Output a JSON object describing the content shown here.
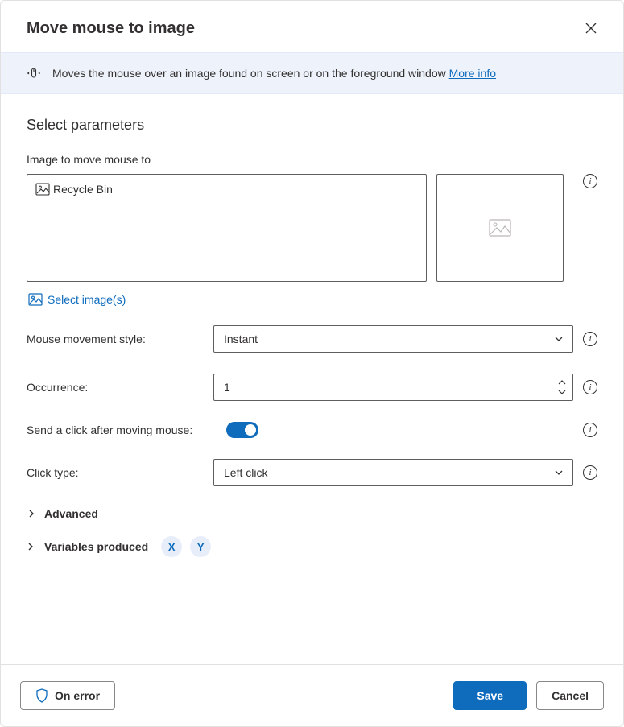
{
  "dialog": {
    "title": "Move mouse to image",
    "description": "Moves the mouse over an image found on screen or on the foreground window",
    "more_info": "More info"
  },
  "section_title": "Select parameters",
  "image_field": {
    "label": "Image to move mouse to",
    "selected_item": "Recycle Bin",
    "select_images": "Select image(s)"
  },
  "params": {
    "movement_style": {
      "label": "Mouse movement style:",
      "value": "Instant"
    },
    "occurrence": {
      "label": "Occurrence:",
      "value": "1"
    },
    "send_click": {
      "label": "Send a click after moving mouse:"
    },
    "click_type": {
      "label": "Click type:",
      "value": "Left click"
    }
  },
  "advanced_label": "Advanced",
  "variables": {
    "label": "Variables produced",
    "items": [
      "X",
      "Y"
    ]
  },
  "footer": {
    "on_error": "On error",
    "save": "Save",
    "cancel": "Cancel"
  }
}
